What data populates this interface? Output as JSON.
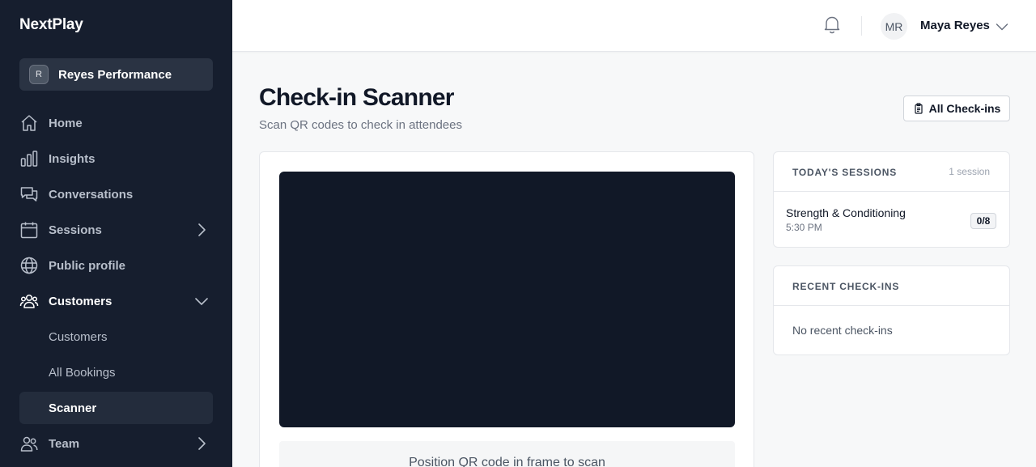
{
  "brand": "NextPlay",
  "org": {
    "initial": "R",
    "name": "Reyes Performance"
  },
  "nav": {
    "home": "Home",
    "insights": "Insights",
    "conversations": "Conversations",
    "sessions": "Sessions",
    "public_profile": "Public profile",
    "customers": "Customers",
    "customers_sub": [
      "Customers",
      "All Bookings",
      "Scanner"
    ],
    "team": "Team",
    "active_item": "Scanner"
  },
  "topbar": {
    "user_initials": "MR",
    "user_name": "Maya Reyes"
  },
  "page": {
    "title": "Check-in Scanner",
    "subtitle": "Scan QR codes to check in attendees",
    "all_checkins_button": "All Check-ins"
  },
  "scanner": {
    "hint": "Position QR code in frame to scan"
  },
  "todays_sessions": {
    "heading": "TODAY'S SESSIONS",
    "count": "1 session",
    "items": [
      {
        "name": "Strength & Conditioning",
        "time": "5:30 PM",
        "checked": "0/8"
      }
    ]
  },
  "recent_checkins": {
    "heading": "RECENT CHECK-INS",
    "empty": "No recent check-ins"
  },
  "colors": {
    "sidebar": "#161e2e",
    "active_item": "#232c3c",
    "camera": "#111827"
  }
}
